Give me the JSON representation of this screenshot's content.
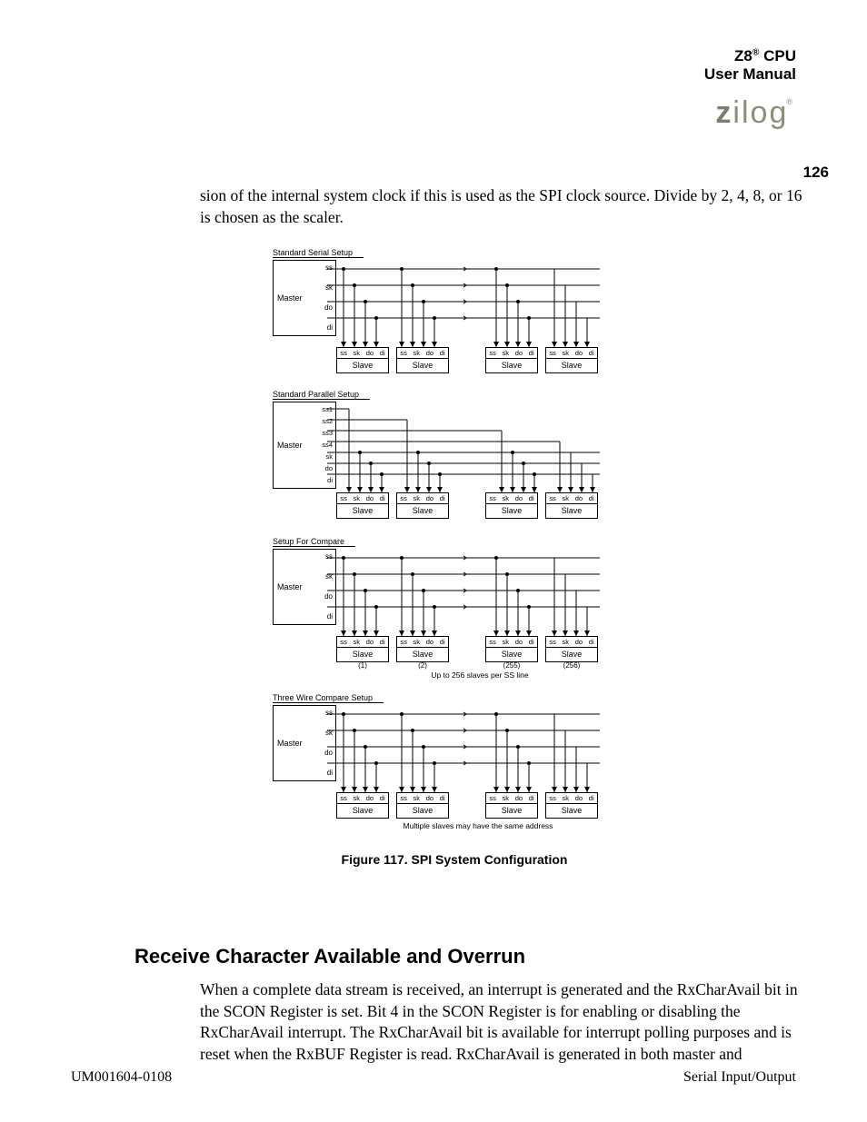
{
  "header": {
    "line1_prefix": "Z8",
    "line1_sup": "®",
    "line1_suffix": " CPU",
    "line2": "User Manual",
    "logo_z": "z",
    "logo_rest": "ilog",
    "logo_reg": "®",
    "page_num": "126"
  },
  "para1": "sion of the internal system clock if this is used as the SPI clock source. Divide by 2, 4, 8, or 16 is chosen as the scaler.",
  "diagram": {
    "sec1_title": "Standard Serial Setup",
    "sec2_title": "Standard Parallel Setup",
    "sec3_title": "Setup For Compare",
    "sec4_title": "Three Wire Compare Setup",
    "master": "Master",
    "pins4": {
      "p1": "ss",
      "p2": "sk",
      "p3": "do",
      "p4": "di"
    },
    "pins7": {
      "p1": "ss1",
      "p2": "ss2",
      "p3": "ss3",
      "p4": "ss4",
      "p5": "sk",
      "p6": "do",
      "p7": "di"
    },
    "slave_pins": {
      "a": "ss",
      "b": "sk",
      "c": "do",
      "d": "di"
    },
    "slave": "Slave",
    "sub1": "(1)",
    "sub2": "(2)",
    "sub255": "(255)",
    "sub256": "(256)",
    "mid3": "Up to 256 slaves per SS line",
    "mid4": "Multiple slaves may have the same address"
  },
  "figure_caption": "Figure 117. SPI System Configuration",
  "section_head": "Receive Character Available and Overrun",
  "para2": "When a complete data stream is received, an interrupt is generated and the RxCharAvail bit in the SCON Register is set. Bit 4 in the SCON Register is for enabling or disabling the RxCharAvail interrupt. The RxCharAvail bit is available for interrupt polling purposes and is reset when the RxBUF Register is read. RxCharAvail is generated in both master and",
  "footer": {
    "left": "UM001604-0108",
    "right": "Serial Input/Output"
  }
}
